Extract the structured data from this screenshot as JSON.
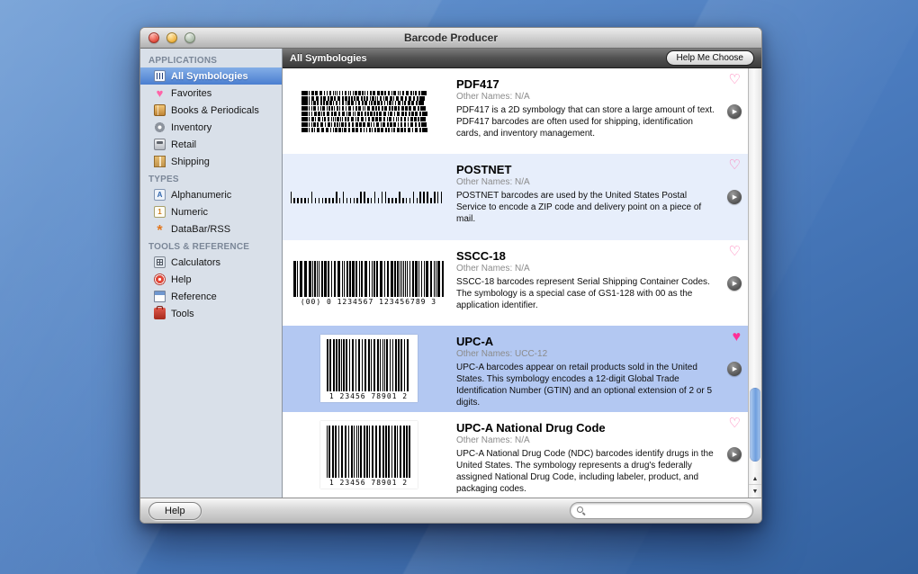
{
  "window": {
    "title": "Barcode Producer",
    "header": {
      "title": "All Symbologies",
      "help_me_choose_label": "Help Me Choose"
    },
    "footer": {
      "help_label": "Help",
      "search": {
        "value": "",
        "placeholder": ""
      }
    },
    "accent_colors": {
      "sidebar_selection": "#4a7ed0",
      "row_selection": "#b3c8f2",
      "favorite_pink": "#ff2f97"
    }
  },
  "sidebar": {
    "sections": [
      {
        "title": "APPLICATIONS",
        "items": [
          {
            "label": "All Symbologies",
            "icon": "barcode-icon",
            "selected": true
          },
          {
            "label": "Favorites",
            "icon": "heart-icon",
            "selected": false
          },
          {
            "label": "Books & Periodicals",
            "icon": "book-icon",
            "selected": false
          },
          {
            "label": "Inventory",
            "icon": "gear-icon",
            "selected": false
          },
          {
            "label": "Retail",
            "icon": "cash-register-icon",
            "selected": false
          },
          {
            "label": "Shipping",
            "icon": "package-icon",
            "selected": false
          }
        ]
      },
      {
        "title": "TYPES",
        "items": [
          {
            "label": "Alphanumeric",
            "icon": "alphanumeric-icon",
            "selected": false
          },
          {
            "label": "Numeric",
            "icon": "numeric-icon",
            "selected": false
          },
          {
            "label": "DataBar/RSS",
            "icon": "databar-icon",
            "selected": false
          }
        ]
      },
      {
        "title": "TOOLS & REFERENCE",
        "items": [
          {
            "label": "Calculators",
            "icon": "calculator-icon",
            "selected": false
          },
          {
            "label": "Help",
            "icon": "help-icon",
            "selected": false
          },
          {
            "label": "Reference",
            "icon": "reference-icon",
            "selected": false
          },
          {
            "label": "Tools",
            "icon": "toolbox-icon",
            "selected": false
          }
        ]
      }
    ]
  },
  "list": {
    "items": [
      {
        "name": "PDF417",
        "other_names": "Other Names: N/A",
        "description": "PDF417 is a 2D symbology that can store a large amount of text. PDF417 barcodes are often used for shipping, identification cards, and inventory management.",
        "barcode_type": "pdf417",
        "barcode_text": "",
        "favorite": false,
        "selected": false
      },
      {
        "name": "POSTNET",
        "other_names": "Other Names: N/A",
        "description": "POSTNET barcodes are used by the United States Postal Service to encode a ZIP code and delivery point on a piece of mail.",
        "barcode_type": "postnet",
        "barcode_text": "",
        "favorite": false,
        "selected": false
      },
      {
        "name": "SSCC-18",
        "other_names": "Other Names: N/A",
        "description": "SSCC-18 barcodes represent Serial Shipping Container Codes. The symbology is a special case of GS1-128 with 00 as the application identifier.",
        "barcode_type": "linear",
        "barcode_text": "(00) 0 1234567 123456789 3",
        "favorite": false,
        "selected": false
      },
      {
        "name": "UPC-A",
        "other_names": "Other Names: UCC-12",
        "description": "UPC-A barcodes appear on retail products sold in the United States. This symbology encodes a 12-digit Global Trade Identification Number (GTIN) and an optional extension of 2 or 5 digits.",
        "barcode_type": "upc",
        "barcode_text": "1 23456 78901 2",
        "favorite": true,
        "selected": true
      },
      {
        "name": "UPC-A National Drug Code",
        "other_names": "Other Names: N/A",
        "description": "UPC-A National Drug Code (NDC) barcodes identify drugs in the United States. The symbology represents a drug's federally assigned National Drug Code, including labeler, product, and packaging codes.",
        "barcode_type": "upc",
        "barcode_text": "1 23456 78901 2",
        "favorite": false,
        "selected": false
      }
    ]
  }
}
